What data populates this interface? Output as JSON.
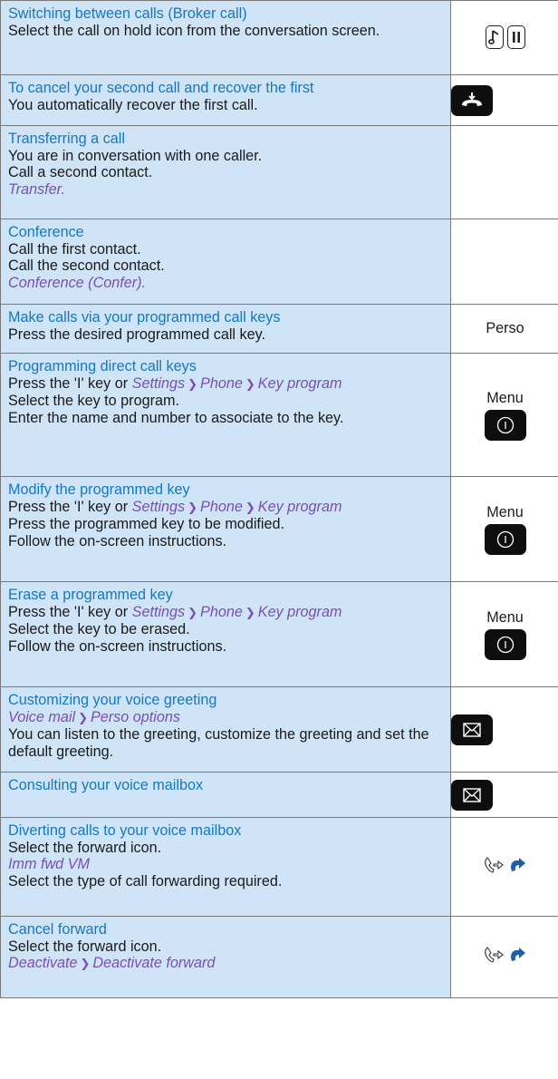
{
  "rows": [
    {
      "title": "Switching between calls (Broker call)",
      "lines": [
        "Select the call on hold icon from the conversation screen."
      ],
      "icon_name": "music-and-pause-keys"
    },
    {
      "title": "To cancel your second call and recover the first",
      "lines": [
        "You automatically recover the first call."
      ],
      "icon_name": "hangup-key"
    },
    {
      "title": "Transferring a call",
      "lines": [
        "You are in conversation with one caller.",
        "Call a second contact."
      ],
      "menu": "Transfer."
    },
    {
      "title": "Conference",
      "lines": [
        "Call the first contact.",
        "Call the second contact."
      ],
      "menu": "Conference (Confer)."
    },
    {
      "title": "Make calls via your programmed call keys",
      "lines": [
        "Press the desired programmed call key."
      ],
      "icon_label": "Perso"
    },
    {
      "title": "Programming direct call keys",
      "lead": "Press the 'I' key or",
      "path": [
        "Settings",
        "Phone",
        "Key program"
      ],
      "lines": [
        "Select the key to program.",
        "Enter the name and number to associate to the key."
      ],
      "icon_label": "Menu",
      "icon_name": "info-key"
    },
    {
      "title": "Modify the programmed key",
      "lead": "Press the 'I' key or",
      "path": [
        "Settings",
        "Phone",
        "Key program"
      ],
      "lines": [
        "Press the programmed key to be modified.",
        "Follow the on-screen instructions."
      ],
      "icon_label": "Menu",
      "icon_name": "info-key"
    },
    {
      "title": "Erase a programmed key",
      "lead": "Press the 'I' key or",
      "path": [
        "Settings",
        "Phone",
        "Key program"
      ],
      "lines": [
        "Select the key to be erased.",
        "Follow the on-screen instructions."
      ],
      "icon_label": "Menu",
      "icon_name": "info-key"
    },
    {
      "title": "Customizing your voice greeting",
      "path": [
        "Voice mail",
        "Perso options"
      ],
      "lines": [
        "You can listen to the greeting, customize the greeting and set the default greeting."
      ],
      "icon_name": "envelope-key"
    },
    {
      "title": "Consulting your voice mailbox",
      "icon_name": "envelope-key"
    },
    {
      "title": "Diverting calls to your voice mailbox",
      "lines": [
        "Select the forward icon."
      ],
      "menu": "Imm fwd VM",
      "lines_after": [
        "Select the type of call forwarding required."
      ],
      "icon_name": "forward-icons"
    },
    {
      "title": "Cancel forward",
      "lines": [
        "Select the forward icon."
      ],
      "path": [
        "Deactivate",
        "Deactivate forward"
      ],
      "icon_name": "forward-icons"
    }
  ],
  "separator": "❯",
  "colors": {
    "band": "#cfe4f6",
    "title": "#1677c2",
    "menu": "#7a4fb5",
    "border": "#7a7a7a"
  }
}
